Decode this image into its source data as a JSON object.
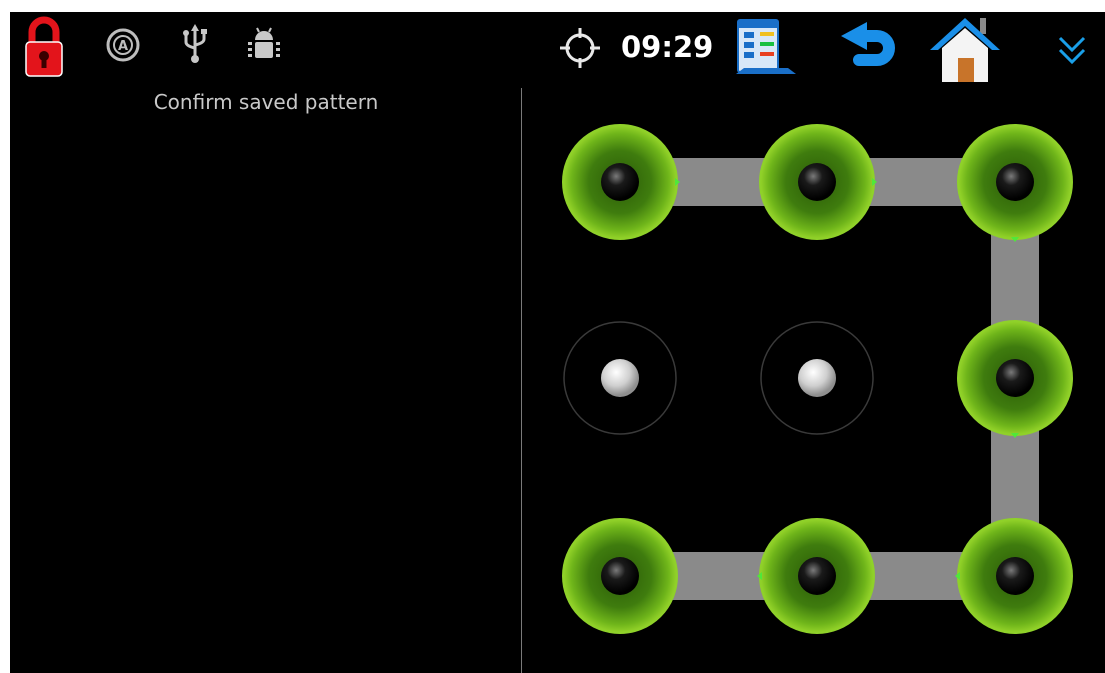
{
  "status_bar": {
    "time": "09:29",
    "icons": [
      "lock-icon",
      "accessibility-icon",
      "usb-icon",
      "android-debug-icon",
      "gps-icon",
      "task-manager-icon",
      "back-icon",
      "home-icon",
      "expand-icon"
    ]
  },
  "prompt": {
    "text": "Confirm saved pattern"
  },
  "pattern": {
    "grid": 3,
    "selected_dots": [
      0,
      1,
      2,
      5,
      8,
      7,
      6
    ],
    "path": [
      0,
      1,
      2,
      5,
      8,
      7,
      6
    ],
    "selected_color": "#7ac11a",
    "path_color": "#8a8a8a"
  },
  "colors": {
    "background": "#000000",
    "lock_red": "#e3141b",
    "accent_blue": "#1a8fe8"
  }
}
